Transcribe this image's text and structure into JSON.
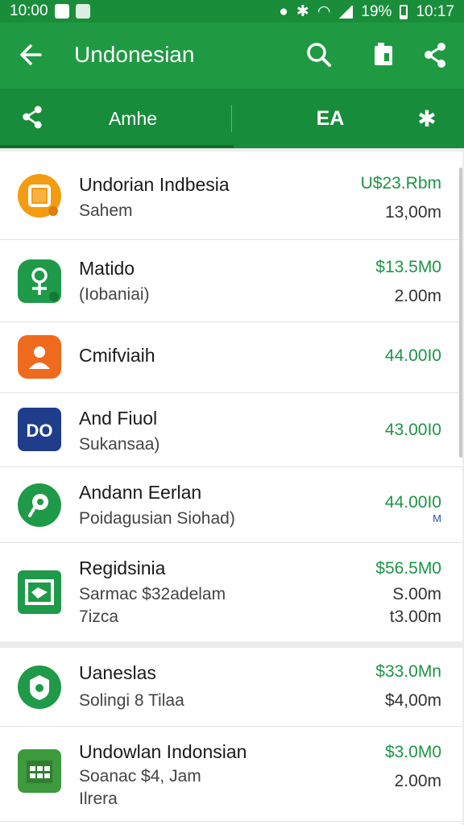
{
  "status_bar": {
    "left_text": "10:00",
    "battery": "19%",
    "time": "10:17"
  },
  "app_bar": {
    "title": "Undonesian"
  },
  "tabs": {
    "tab1": "Amhe",
    "tab2": "EA"
  },
  "rows": [
    {
      "name": "Undorian Indbesia",
      "sub": "Sahem",
      "price": "U$23.Rbm",
      "amount": "13,00m",
      "icon_color": "#f39c12"
    },
    {
      "name": "Matido",
      "sub": "(Iobaniai)",
      "price": "$13.5M0",
      "amount": "2.00m",
      "icon_color": "#1e9a48"
    },
    {
      "name": "Cmifviaih",
      "price": "44.00I0",
      "icon_color": "#f06a1e"
    },
    {
      "name": "And Fiuol",
      "sub": "Sukansaa)",
      "price": "43.00I0",
      "icon_color": "#1f3d8a"
    },
    {
      "name": "Andann Eerlan",
      "sub": "Poidagusian Siohad)",
      "price": "44.00I0",
      "price_note": "M",
      "icon_color": "#1e9a48"
    },
    {
      "name": "Regidsinia",
      "sub": "Sarmac $32adelam",
      "sub2": "7izca",
      "price": "$56.5M0",
      "amount": "S.00m",
      "amount2": "t3.00m",
      "icon_color": "#1e9a48"
    },
    {
      "name": "Uaneslas",
      "sub": "Solingi 8 Tilaa",
      "price": "$33.0Mn",
      "amount": "$4,00m",
      "icon_color": "#1e9a48"
    },
    {
      "name": "Undowlan Indonsian",
      "sub": "Soanac $4, Jam",
      "sub2": "Ilrera",
      "price": "$3.0M0",
      "amount": "2.00m",
      "icon_color": "#3d9a3d"
    }
  ]
}
